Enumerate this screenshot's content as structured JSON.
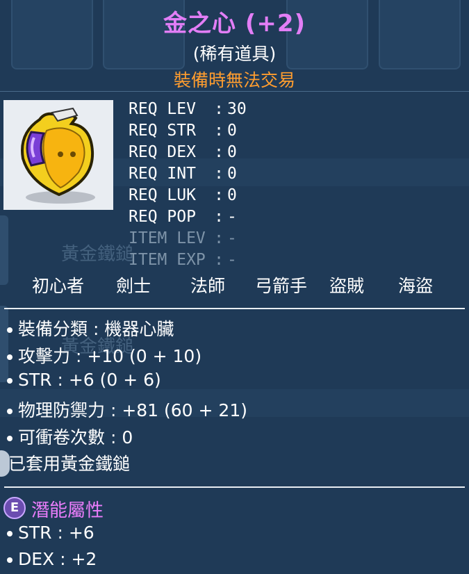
{
  "item": {
    "name": "金之心 (+2)",
    "rarity": "(稀有道具)",
    "trade_note": "裝備時無法交易",
    "icon": "golden-heart-icon"
  },
  "requirements": [
    {
      "key": "REQ LEV",
      "value": "30"
    },
    {
      "key": "REQ STR",
      "value": "0"
    },
    {
      "key": "REQ DEX",
      "value": "0"
    },
    {
      "key": "REQ INT",
      "value": "0"
    },
    {
      "key": "REQ LUK",
      "value": "0"
    },
    {
      "key": "REQ POP",
      "value": "-"
    },
    {
      "key": "ITEM LEV",
      "value": "-"
    },
    {
      "key": "ITEM EXP",
      "value": "-"
    }
  ],
  "jobs": [
    "初心者",
    "劍士",
    "法師",
    "弓箭手",
    "盜賊",
    "海盜"
  ],
  "stats": [
    "裝備分類 : 機器心臟",
    "攻擊力 : +10 (0 + 10)",
    "STR : +6 (0 + 6)",
    "物理防禦力 : +81 (60 + 21)",
    "可衝卷次數 : 0"
  ],
  "set_note": "已套用黃金鐵鎚",
  "potential": {
    "badge": "E",
    "label": "潛能屬性",
    "lines": [
      "STR : +6",
      "DEX : +2"
    ]
  },
  "background_ghost_text": [
    "黃金鐵鎚",
    "黃金鐵鎚"
  ],
  "colors": {
    "title": "#e27ef6",
    "trade_note": "#ff9d2f",
    "potential": "#ea7dfb",
    "panel": "#1f3a57"
  }
}
